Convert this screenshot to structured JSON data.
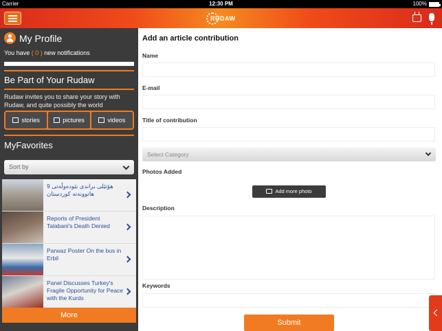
{
  "status_bar": {
    "carrier": "Carrier",
    "time": "12:30 PM",
    "battery": "100%"
  },
  "header": {
    "logo_text": "RUDAW"
  },
  "profile": {
    "title": "My Profile",
    "notif_prefix": "You have",
    "notif_count": "( 0 )",
    "notif_suffix": "new notifications"
  },
  "contribute": {
    "title": "Be Part of Your Rudaw",
    "invite_text": "Rudaw invites you to share your story with Rudaw, and quite possibly the world",
    "buttons": [
      "stories",
      "pictures",
      "videos"
    ]
  },
  "favorites": {
    "title": "MyFavorites",
    "sort_placeholder": "Sort by",
    "items": [
      "9 هۆتێلی براندی نێودەوڵەتی هاتوونەتە کوردستان",
      "Reports of President Talabani's Death Denied",
      "Parwaz Poster On the bus in Erbil",
      "Panel Discusses Turkey's Fragile Opportunity for Peace with the Kurds"
    ],
    "more_label": "More"
  },
  "form": {
    "title": "Add an article contribution",
    "name_label": "Name",
    "email_label": "E-mail",
    "contrib_title_label": "Title of contribution",
    "category_placeholder": "Select Category",
    "photos_label": "Photos Added",
    "add_photo_label": "Add more photo",
    "description_label": "Description",
    "keywords_label": "Keywords",
    "submit_label": "Submit"
  },
  "colors": {
    "accent": "#f07b22",
    "header_red": "#e23b1c",
    "sidebar_bg": "#3b3b3b",
    "link_blue": "#2a4f9a"
  }
}
